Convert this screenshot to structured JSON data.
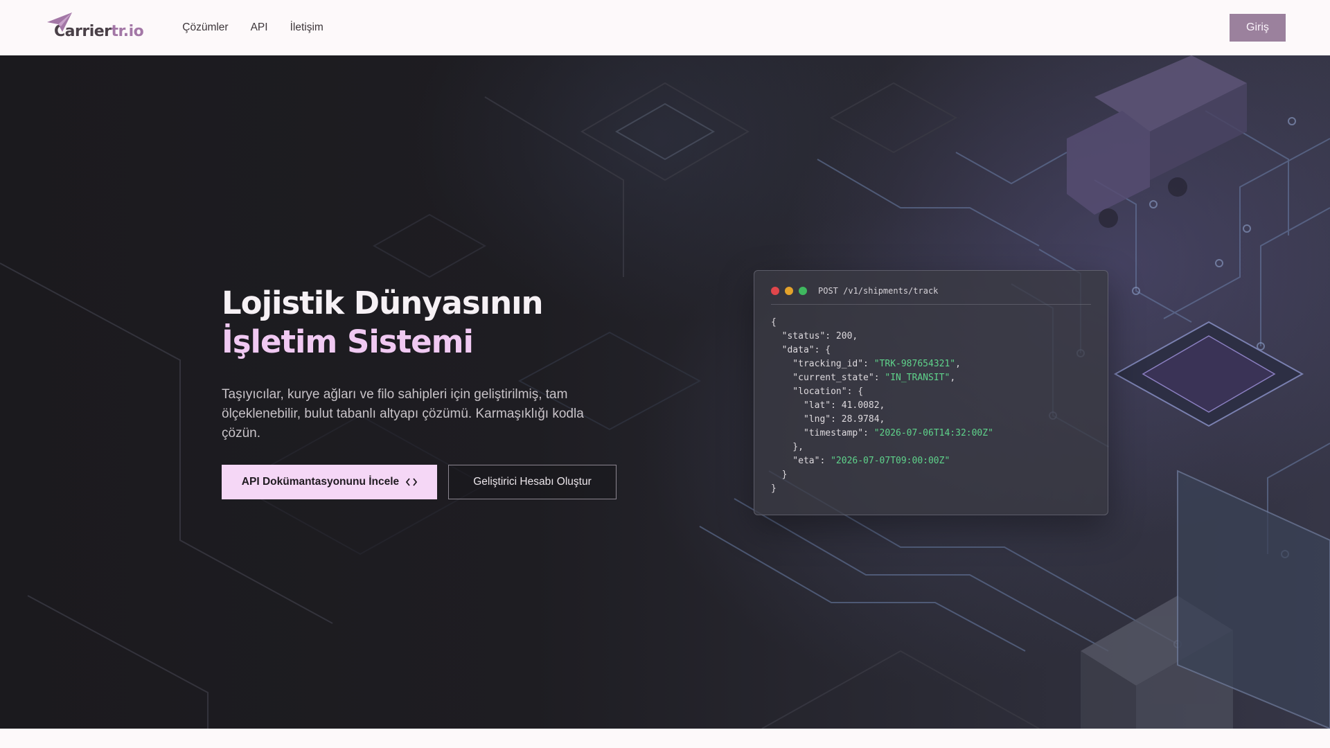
{
  "brand": {
    "name_part1": "Carrier",
    "name_part2": "tr.io"
  },
  "nav": {
    "links": [
      "Çözümler",
      "API",
      "İletişim"
    ],
    "login_label": "Giriş"
  },
  "hero": {
    "title_main": "Lojistik Dünyasının ",
    "title_accent": "İşletim Sistemi",
    "subtitle": "Taşıyıcılar, kurye ağları ve filo sahipleri için geliştirilmiş, tam ölçeklenebilir, bulut tabanlı altyapı çözümü. Karmaşıklığı kodla çözün.",
    "primary_cta": "API Dokümantasyonunu İncele",
    "primary_cta_icon": "code-brackets-icon",
    "secondary_cta": "Geliştirici Hesabı Oluştur"
  },
  "code_card": {
    "endpoint": "POST /v1/shipments/track",
    "dot_colors": [
      "#e0464b",
      "#e3a22b",
      "#3fb85f"
    ],
    "response": {
      "status": 200,
      "tracking_id": "TRK-987654321",
      "current_state": "IN_TRANSIT",
      "lat": "41.0082",
      "lng": "28.9784",
      "timestamp": "2026-07-06T14:32:00Z",
      "eta": "2026-07-07T09:00:00Z"
    }
  },
  "colors": {
    "accent": "#f0c9f2",
    "button_primary": "#f5d7f6",
    "login_button": "#9b819d",
    "brand_light": "#a377a6",
    "json_string": "#5fd38b"
  }
}
